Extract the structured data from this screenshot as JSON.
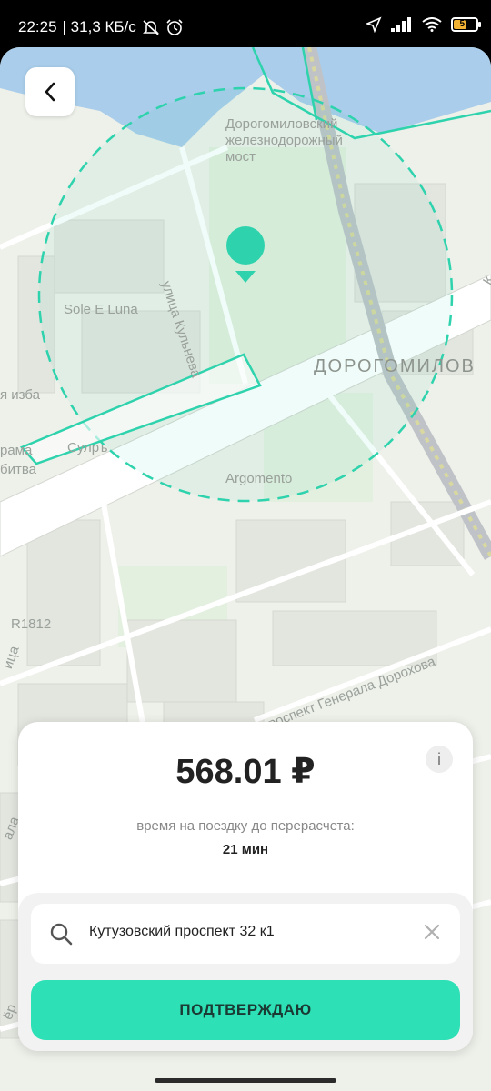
{
  "status_bar": {
    "time": "22:25",
    "speed": "| 31,3 КБ/с",
    "battery_level": "57",
    "icons": [
      "mute-icon",
      "alarm-icon",
      "location-arrow-icon",
      "signal-icon",
      "wifi-icon",
      "battery-icon"
    ]
  },
  "map": {
    "labels": {
      "bridge": "Дорогомиловский\nжелезнодорожный\nмост",
      "street_kulneva": "улица Кульнева",
      "sole_luna": "Sole E Luna",
      "dorogomilovo": "ДОРОГОМИЛОВ",
      "izba": "я изба",
      "sulra": "Сулръ",
      "panorama": "рама",
      "bitva": "битва",
      "argomento": "Argomento",
      "r1812": "R1812",
      "doroxova": "проспект Генерала Дорохова",
      "side_left": "ица",
      "side_left2": "ала",
      "side_left3": "ёр",
      "edge_k": "К"
    },
    "colors": {
      "accent": "#2ed3ad",
      "water": "#a9cdea"
    }
  },
  "back_button": {
    "icon": "chevron-left-icon"
  },
  "sheet": {
    "price": "568.01 ₽",
    "info": "i",
    "caption": "время на поездку до перерасчета:",
    "duration": "21 мин",
    "address": "Кутузовский проспект 32 к1",
    "confirm_label": "ПОДТВЕРЖДАЮ"
  }
}
